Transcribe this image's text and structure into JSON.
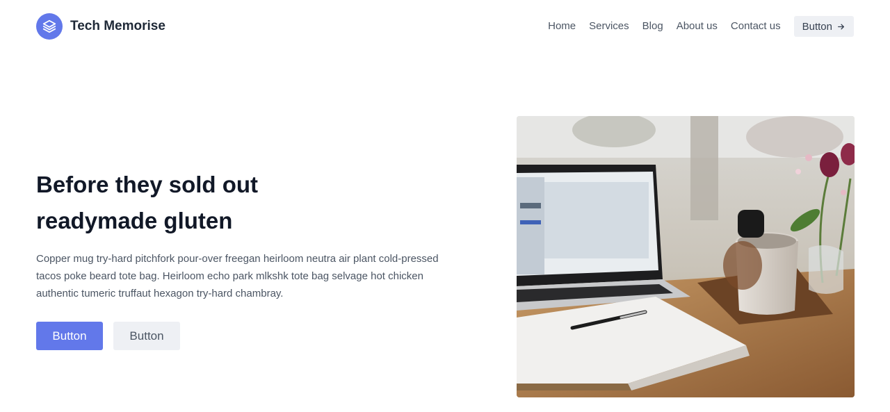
{
  "brand": {
    "name": "Tech Memorise",
    "icon": "layers-icon"
  },
  "nav": {
    "items": [
      "Home",
      "Services",
      "Blog",
      "About us",
      "Contact us"
    ],
    "button_label": "Button",
    "button_icon": "arrow-right-icon"
  },
  "hero": {
    "title_line1": "Before they sold out",
    "title_line2": "readymade gluten",
    "description": "Copper mug try-hard pitchfork pour-over freegan heirloom neutra air plant cold-pressed tacos poke beard tote bag. Heirloom echo park mlkshk tote bag selvage hot chicken authentic tumeric truffaut hexagon try-hard chambray.",
    "primary_button": "Button",
    "secondary_button": "Button"
  },
  "colors": {
    "accent": "#6278ea",
    "light_button": "#eef0f4"
  }
}
